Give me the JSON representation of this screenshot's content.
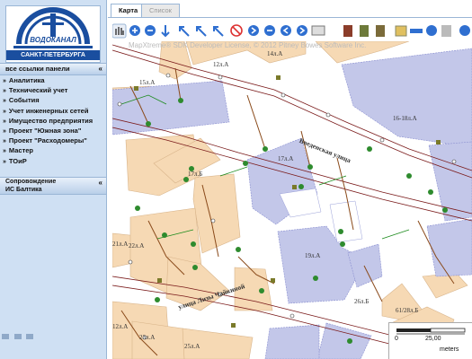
{
  "logo": {
    "line1": "ВОДОКАНАЛ",
    "line2": "САНКТ-ПЕТЕРБУРГА"
  },
  "panel": {
    "header": "все ссылки панели",
    "chevron": "«"
  },
  "menu": [
    "Аналитика",
    "Технический учет",
    "События",
    "Учет инженерных сетей",
    "Имущество предприятия",
    "Проект \"Южная зона\"",
    "Проект \"Расходомеры\"",
    "Мастер",
    "ТОиР"
  ],
  "support": {
    "line1": "Сопровождение",
    "line2": "ИС Балтика",
    "chevron": "«"
  },
  "tabs": {
    "active": "Карта",
    "inactive": "Список"
  },
  "watermark": "MapXtreme® SDK Developer License, © 2012 Pitney Bowes Software Inc.",
  "map": {
    "labels": [
      "12л.А",
      "14л.А",
      "15л.А",
      "16-18л.А",
      "17л.Б",
      "17л.А",
      "19л.А",
      "22л.А",
      "21л.А",
      "23л.А",
      "25л.А",
      "26л.Б",
      "61/28л.Б",
      "12л.А"
    ],
    "streets": [
      "Введенская улица",
      "улица Лизы Чайкиной"
    ]
  },
  "scale": {
    "zero": "0",
    "mid": "25,00",
    "unit": "meters"
  },
  "colors": {
    "panel_bg": "#cfe0f3",
    "building_orange": "#f6d9b4",
    "building_blue": "#c3c7e9",
    "pipe": "#7a1a1a",
    "node_green": "#2e8b2e"
  }
}
